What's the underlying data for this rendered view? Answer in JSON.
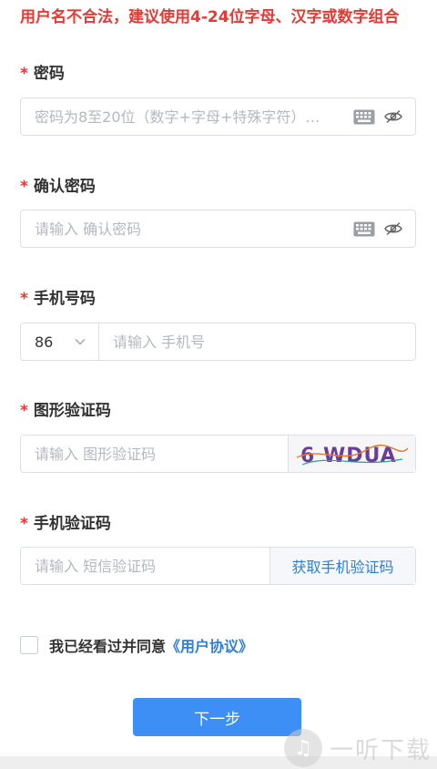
{
  "error": "用户名不合法，建议使用4-24位字母、汉字或数字组合",
  "required_mark": "*",
  "password": {
    "label": "密码",
    "placeholder": "密码为8至20位（数字+字母+特殊字符）…"
  },
  "confirm": {
    "label": "确认密码",
    "placeholder": "请输入 确认密码"
  },
  "phone": {
    "label": "手机号码",
    "country_code": "86",
    "placeholder": "请输入 手机号"
  },
  "captcha": {
    "label": "图形验证码",
    "placeholder": "请输入 图形验证码",
    "image_text": "6 WDUA"
  },
  "sms": {
    "label": "手机验证码",
    "placeholder": "请输入 短信验证码",
    "button": "获取手机验证码"
  },
  "agreement": {
    "text": "我已经看过并同意",
    "link": "《用户协议》"
  },
  "next_button": "下一步",
  "watermark": "一听下载",
  "colors": {
    "error": "#e53935",
    "primary": "#3d8ff5",
    "link": "#2f7fd9"
  }
}
